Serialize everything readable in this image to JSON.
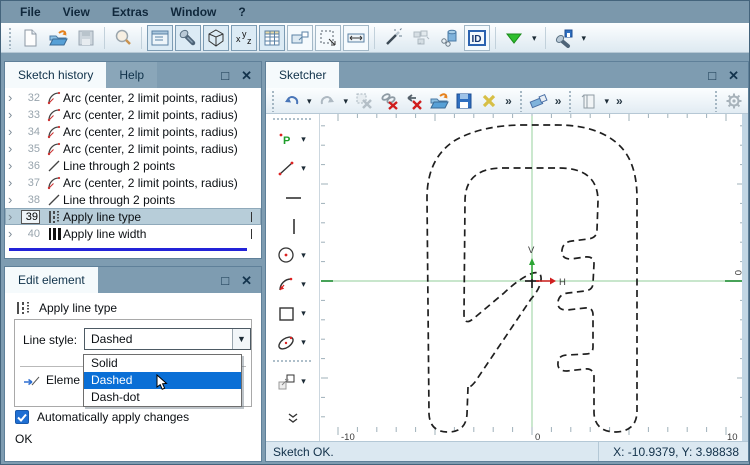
{
  "window": {
    "menu_items": [
      "File",
      "View",
      "Extras",
      "Window",
      "?"
    ]
  },
  "icons": {
    "id_label": "ID",
    "xyz_label": "xyz",
    "point_label": "P"
  },
  "sketch_history": {
    "tabs": {
      "active": "Sketch history",
      "inactive": "Help"
    },
    "rows": [
      {
        "num": "32",
        "icon": "arc-icon",
        "label": "Arc (center, 2 limit points, radius)"
      },
      {
        "num": "33",
        "icon": "arc-icon",
        "label": "Arc (center, 2 limit points, radius)"
      },
      {
        "num": "34",
        "icon": "arc-icon",
        "label": "Arc (center, 2 limit points, radius)"
      },
      {
        "num": "35",
        "icon": "arc-icon",
        "label": "Arc (center, 2 limit points, radius)"
      },
      {
        "num": "36",
        "icon": "line-icon",
        "label": "Line through 2 points"
      },
      {
        "num": "37",
        "icon": "arc-icon",
        "label": "Arc (center, 2 limit points, radius)"
      },
      {
        "num": "38",
        "icon": "line-icon",
        "label": "Line through 2 points"
      },
      {
        "num": "39",
        "icon": "line-type-icon",
        "label": "Apply line type",
        "selected": true,
        "tick": true
      },
      {
        "num": "40",
        "icon": "line-width-icon",
        "label": "Apply line width",
        "tick": true
      }
    ]
  },
  "edit_element": {
    "title": "Edit element",
    "operation_label": "Apply line type",
    "line_style_label": "Line style:",
    "line_style_value": "Dashed",
    "dropdown_options": [
      "Solid",
      "Dashed",
      "Dash-dot"
    ],
    "dropdown_selected": "Dashed",
    "element_label_partial": "Eleme",
    "auto_apply_label": "Automatically apply changes",
    "auto_apply_checked": true,
    "status_label": "OK"
  },
  "sketcher": {
    "title": "Sketcher",
    "ruler": {
      "x_min_label": "-10",
      "x_zero_label": "0",
      "x_max_label": "10",
      "y_zero_label": "0"
    },
    "axes": {
      "vertical_label": "V",
      "horizontal_label": "H"
    },
    "status": {
      "message": "Sketch OK.",
      "coordinates": "X: -10.9379, Y: 3.98838"
    }
  },
  "colors": {
    "steel_background": "#7e9cb1",
    "selection_blue": "#0a6fd6",
    "history_selected": "#b7cdd9",
    "divider_blue": "#2323d8",
    "axis_green": "#a8d8ae",
    "accent_red": "#cf1f1f",
    "accent_green": "#2ca534"
  }
}
